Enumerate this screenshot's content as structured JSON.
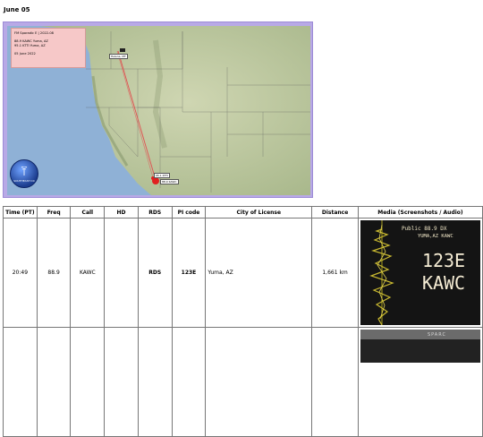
{
  "page": {
    "date_heading": "June 05"
  },
  "map": {
    "title_line": "FM Sporadic E  |  2022-08",
    "station_line_1": "88.9 KAWC Yuma, AZ",
    "station_line_2": "95.1 KTTI Yuma, AZ",
    "date_line": "05 June 2022",
    "rx_label": "Helena, MT",
    "tx_label_1": "95.1 KTTI",
    "tx_label_2": "88.9 KAWC",
    "logo_text": "SOUTHEAST DX"
  },
  "table": {
    "headers": [
      "Time (PT)",
      "Freq",
      "Call",
      "HD",
      "RDS",
      "PI code",
      "City of License",
      "Distance",
      "Media (Screenshots / Audio)"
    ],
    "rows": [
      {
        "time": "20:49",
        "freq": "88.9",
        "call": "KAWC",
        "hd": "",
        "rds": "RDS",
        "pi": "123E",
        "city": "Yuma, AZ",
        "distance": "1,661 km",
        "media": {
          "line1": "Public  88.9  DX",
          "line2": "YUMA,AZ  KAWC",
          "pi": "123E",
          "call": "KAWC"
        }
      },
      {
        "time": "",
        "freq": "",
        "call": "",
        "hd": "",
        "rds": "",
        "pi": "",
        "city": "",
        "distance": "",
        "media": {
          "brand": "SPARC"
        }
      }
    ]
  },
  "colors": {
    "map_frame": "#b8a9e6",
    "info_box": "#f6c8c8",
    "path_line": "#e05050",
    "tx_marker": "#e02020"
  }
}
